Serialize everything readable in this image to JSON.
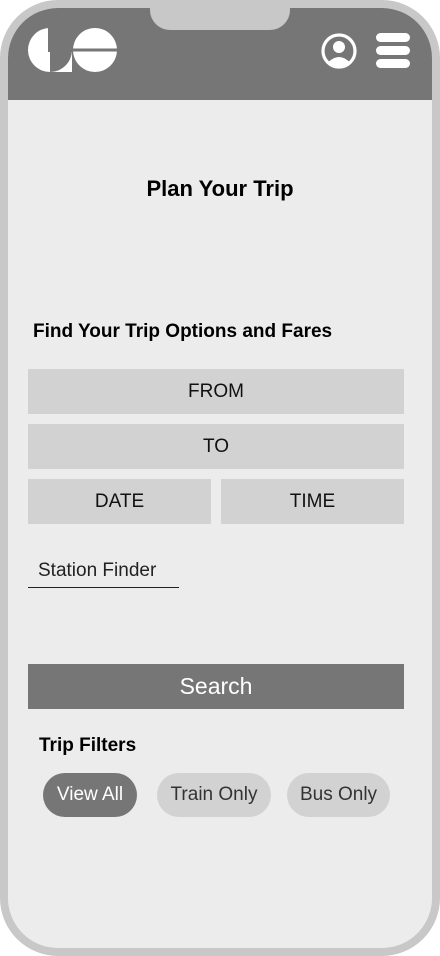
{
  "header": {
    "logo_icon": "go-transit-logo",
    "account_icon": "user-circle-icon",
    "menu_icon": "hamburger-menu-icon",
    "background_color": "#767676"
  },
  "main": {
    "page_title": "Plan Your Trip",
    "section_title": "Find Your Trip Options and Fares",
    "fields": {
      "from": "FROM",
      "to": "TO",
      "date": "DATE",
      "time": "TIME"
    },
    "station_finder_label": "Station Finder",
    "search_label": "Search"
  },
  "filters": {
    "title": "Trip Filters",
    "options": [
      "View All",
      "Train Only",
      "Bus Only"
    ],
    "selected": "View All",
    "selected_color": "#767676",
    "unselected_color": "#d2d2d2"
  }
}
